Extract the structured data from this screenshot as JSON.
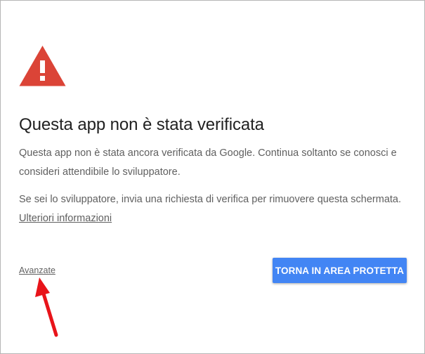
{
  "dialog": {
    "title": "Questa app non è stata verificata",
    "paragraph1": "Questa app non è stata ancora verificata da Google. Continua soltanto se conosci e consideri attendibile lo sviluppatore.",
    "paragraph2": "Se sei lo sviluppatore, invia una richiesta di verifica per rimuovere questa schermata.",
    "learn_more_link": "Ulteriori informazioni",
    "advanced_link": "Avanzate",
    "back_button": "TORNA IN AREA PROTETTA"
  },
  "icons": {
    "warning": "warning-triangle-icon",
    "annotation": "red-arrow-icon"
  },
  "colors": {
    "warning_red": "#db4437",
    "button_blue": "#4285f4",
    "body_text": "#5f5f5f",
    "title_text": "#212121",
    "annotation_red": "#e8141a"
  }
}
